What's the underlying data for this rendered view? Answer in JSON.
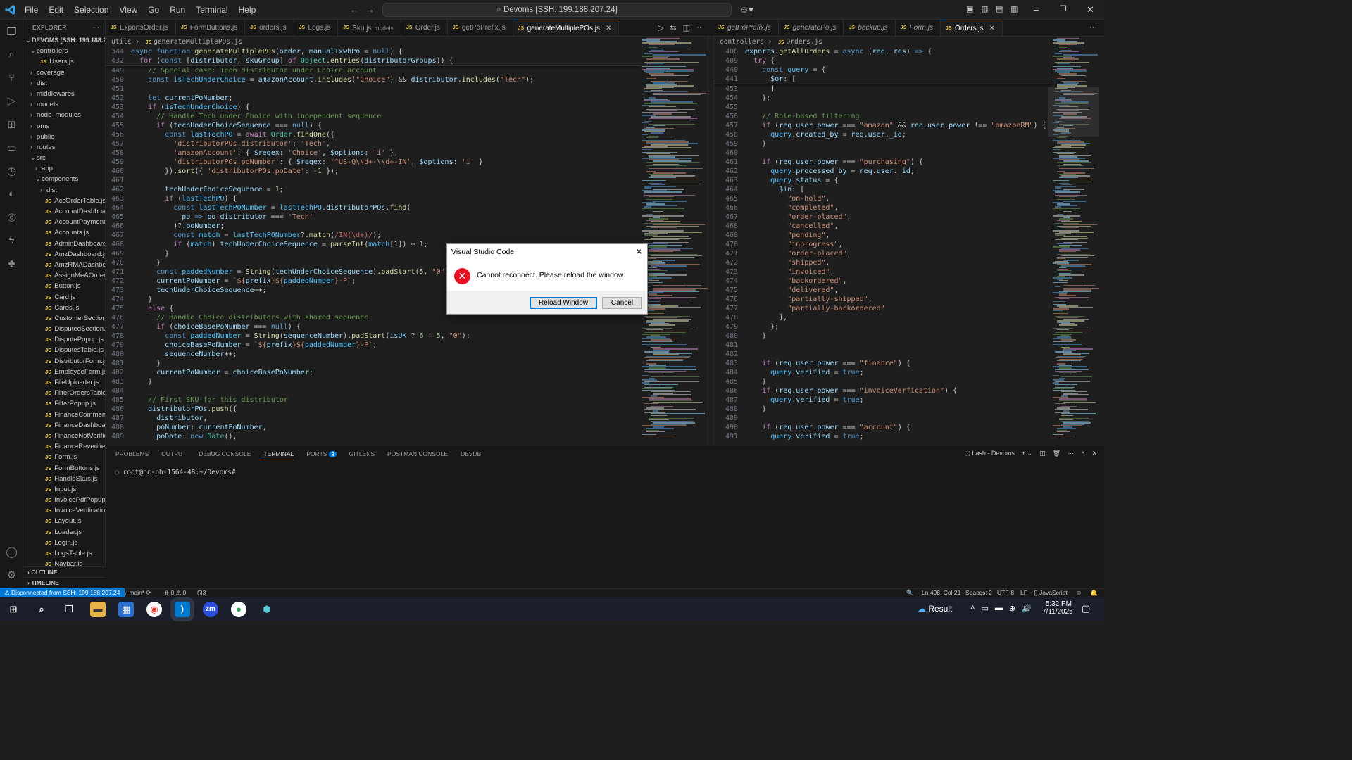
{
  "titlebar": {
    "menu": [
      "File",
      "Edit",
      "Selection",
      "View",
      "Go",
      "Run",
      "Terminal",
      "Help"
    ],
    "command_center": "Devoms [SSH: 199.188.207.24]"
  },
  "explorer": {
    "header": "EXPLORER",
    "root": "DEVOMS [SSH: 199.188.20...",
    "items": [
      {
        "label": "controllers",
        "type": "folder",
        "open": true,
        "depth": 1
      },
      {
        "label": "Users.js",
        "type": "js",
        "depth": 2
      },
      {
        "label": "coverage",
        "type": "folder",
        "depth": 1
      },
      {
        "label": "dist",
        "type": "folder",
        "depth": 1
      },
      {
        "label": "middlewares",
        "type": "folder",
        "depth": 1
      },
      {
        "label": "models",
        "type": "folder",
        "depth": 1
      },
      {
        "label": "node_modules",
        "type": "folder",
        "depth": 1
      },
      {
        "label": "oms",
        "type": "folder",
        "depth": 1
      },
      {
        "label": "public",
        "type": "folder",
        "depth": 1
      },
      {
        "label": "routes",
        "type": "folder",
        "depth": 1
      },
      {
        "label": "src",
        "type": "folder",
        "open": true,
        "depth": 1
      },
      {
        "label": "app",
        "type": "folder",
        "depth": 2
      },
      {
        "label": "components",
        "type": "folder",
        "open": true,
        "depth": 2
      },
      {
        "label": "dist",
        "type": "folder",
        "depth": 3
      },
      {
        "label": "AccOrderTable.js",
        "type": "js",
        "depth": 3
      },
      {
        "label": "AccountDashboar...",
        "type": "js",
        "depth": 3
      },
      {
        "label": "AccountPaymentP...",
        "type": "js",
        "depth": 3
      },
      {
        "label": "Accounts.js",
        "type": "js",
        "depth": 3
      },
      {
        "label": "AdminDashboard.js",
        "type": "js",
        "depth": 3
      },
      {
        "label": "AmzDashboard.js",
        "type": "js",
        "depth": 3
      },
      {
        "label": "AmzRMADashboar...",
        "type": "js",
        "depth": 3
      },
      {
        "label": "AssignMeAOrder.js",
        "type": "js",
        "depth": 3
      },
      {
        "label": "Button.js",
        "type": "js",
        "depth": 3
      },
      {
        "label": "Card.js",
        "type": "js",
        "depth": 3
      },
      {
        "label": "Cards.js",
        "type": "js",
        "depth": 3
      },
      {
        "label": "CustomerSection.js",
        "type": "js",
        "depth": 3
      },
      {
        "label": "DisputedSection.js",
        "type": "js",
        "depth": 3
      },
      {
        "label": "DisputePopup.js",
        "type": "js",
        "depth": 3
      },
      {
        "label": "DisputesTable.js",
        "type": "js",
        "depth": 3
      },
      {
        "label": "DistributorForm.js",
        "type": "js",
        "depth": 3
      },
      {
        "label": "EmployeeForm.js",
        "type": "js",
        "depth": 3
      },
      {
        "label": "FileUploader.js",
        "type": "js",
        "depth": 3
      },
      {
        "label": "FilterOrdersTable.js",
        "type": "js",
        "depth": 3
      },
      {
        "label": "FilterPopup.js",
        "type": "js",
        "depth": 3
      },
      {
        "label": "FinanceComments.js",
        "type": "js",
        "depth": 3
      },
      {
        "label": "FinanceDashboard.js",
        "type": "js",
        "depth": 3
      },
      {
        "label": "FinanceNotVerified...",
        "type": "js",
        "depth": 3
      },
      {
        "label": "FinanceReverified...",
        "type": "js",
        "depth": 3
      },
      {
        "label": "Form.js",
        "type": "js",
        "depth": 3
      },
      {
        "label": "FormButtons.js",
        "type": "js",
        "depth": 3
      },
      {
        "label": "HandleSkus.js",
        "type": "js",
        "depth": 3
      },
      {
        "label": "Input.js",
        "type": "js",
        "depth": 3
      },
      {
        "label": "InvoicePdfPopup.js",
        "type": "js",
        "depth": 3
      },
      {
        "label": "InvoiceVerification...",
        "type": "js",
        "depth": 3
      },
      {
        "label": "Layout.js",
        "type": "js",
        "depth": 3
      },
      {
        "label": "Loader.js",
        "type": "js",
        "depth": 3
      },
      {
        "label": "Login.js",
        "type": "js",
        "depth": 3
      },
      {
        "label": "LogsTable.js",
        "type": "js",
        "depth": 3
      },
      {
        "label": "Navbar.js",
        "type": "js",
        "depth": 3
      }
    ],
    "outline": "OUTLINE",
    "timeline": "TIMELINE"
  },
  "tabs_left": [
    {
      "label": "ExportsOrder.js"
    },
    {
      "label": "FormButtons.js"
    },
    {
      "label": "orders.js"
    },
    {
      "label": "Logs.js"
    },
    {
      "label": "Sku.js",
      "desc": "models"
    },
    {
      "label": "Order.js"
    },
    {
      "label": "getPoPrefix.js"
    },
    {
      "label": "generateMultiplePOs.js",
      "active": true
    }
  ],
  "tabs_right": [
    {
      "label": "getPoPrefix.js",
      "italic": true
    },
    {
      "label": "generatePo.js",
      "italic": true
    },
    {
      "label": "backup.js",
      "italic": true
    },
    {
      "label": "Form.js",
      "italic": true
    },
    {
      "label": "Orders.js",
      "active": true
    }
  ],
  "left_editor": {
    "breadcrumb": [
      "utils",
      "generateMultiplePOs.js"
    ],
    "sticky": [
      {
        "n": "344",
        "html": "<span class='kw'>async</span> <span class='kw'>function</span> <span class='fn'>generateMultiplePOs</span><span class='pun'>(</span><span class='var'>order</span>, <span class='var'>manualTxwhPo</span> = <span class='kw'>null</span><span class='pun'>) {</span>"
      },
      {
        "n": "432",
        "html": "  <span class='kw2'>for</span> (<span class='kw'>const</span> [<span class='var'>distributor</span>, <span class='var'>skuGroup</span>] <span class='kw2'>of</span> <span class='cls'>Object</span>.<span class='fn'>entries</span>(<span class='var'>distributorGroups</span>)) {"
      }
    ],
    "lines": [
      {
        "n": "449",
        "html": "    <span class='cmt'>// Special case: Tech distributor under Choice account</span>"
      },
      {
        "n": "450",
        "html": "    <span class='kw'>const</span> <span class='cst'>isTechUnderChoice</span> = <span class='var'>amazonAccount</span>.<span class='fn'>includes</span>(<span class='str'>\"Choice\"</span>) &amp;&amp; <span class='var'>distributor</span>.<span class='fn'>includes</span>(<span class='str'>\"Tech\"</span>);"
      },
      {
        "n": "451",
        "html": ""
      },
      {
        "n": "452",
        "html": "    <span class='kw'>let</span> <span class='var'>currentPoNumber</span>;"
      },
      {
        "n": "453",
        "html": "    <span class='kw2'>if</span> (<span class='cst'>isTechUnderChoice</span>) {"
      },
      {
        "n": "454",
        "html": "      <span class='cmt'>// Handle Tech under Choice with independent sequence</span>"
      },
      {
        "n": "455",
        "html": "      <span class='kw2'>if</span> (<span class='var'>techUnderChoiceSequence</span> === <span class='kw'>null</span>) {"
      },
      {
        "n": "456",
        "html": "        <span class='kw'>const</span> <span class='cst'>lastTechPO</span> = <span class='kw2'>await</span> <span class='cls'>Order</span>.<span class='fn'>findOne</span>({"
      },
      {
        "n": "457",
        "html": "          <span class='str'>'distributorPOs.distributor'</span>: <span class='str'>'Tech'</span>,"
      },
      {
        "n": "458",
        "html": "          <span class='str'>'amazonAccount'</span>: { <span class='var'>$regex</span>: <span class='str'>'Choice'</span>, <span class='var'>$options</span>: <span class='str'>'i'</span> },"
      },
      {
        "n": "459",
        "html": "          <span class='str'>'distributorPOs.poNumber'</span>: { <span class='var'>$regex</span>: <span class='str'>'^US-Q\\\\d+-\\\\d+-IN'</span>, <span class='var'>$options</span>: <span class='str'>'i'</span> }"
      },
      {
        "n": "460",
        "html": "        }).<span class='fn'>sort</span>({ <span class='str'>'distributorPOs.poDate'</span>: <span class='num'>-1</span> });"
      },
      {
        "n": "461",
        "html": ""
      },
      {
        "n": "462",
        "html": "        <span class='var'>techUnderChoiceSequence</span> = <span class='num'>1</span>;"
      },
      {
        "n": "463",
        "html": "        <span class='kw2'>if</span> (<span class='cst'>lastTechPO</span>) {"
      },
      {
        "n": "464",
        "html": "          <span class='kw'>const</span> <span class='cst'>lastTechPONumber</span> = <span class='cst'>lastTechPO</span>.<span class='var'>distributorPOs</span>.<span class='fn'>find</span>("
      },
      {
        "n": "465",
        "html": "            <span class='var'>po</span> <span class='kw'>=&gt;</span> <span class='var'>po</span>.<span class='var'>distributor</span> === <span class='str'>'Tech'</span>"
      },
      {
        "n": "466",
        "html": "          )?.<span class='var'>poNumber</span>;"
      },
      {
        "n": "467",
        "html": "          <span class='kw'>const</span> <span class='cst'>match</span> = <span class='cst'>lastTechPONumber</span>?.<span class='fn'>match</span>(<span class='rx'>/IN(\\d+)/</span>);"
      },
      {
        "n": "468",
        "html": "          <span class='kw2'>if</span> (<span class='cst'>match</span>) <span class='var'>techUnderChoiceSequence</span> = <span class='fn'>parseInt</span>(<span class='cst'>match</span>[<span class='num'>1</span>]) + <span class='num'>1</span>;"
      },
      {
        "n": "469",
        "html": "        }"
      },
      {
        "n": "470",
        "html": "      }"
      },
      {
        "n": "471",
        "html": "      <span class='kw'>const</span> <span class='cst'>paddedNumber</span> = <span class='fn'>String</span>(<span class='var'>techUnderChoiceSequence</span>).<span class='fn'>padStart</span>(<span class='num'>5</span>, <span class='str'>\"0\"</span>);"
      },
      {
        "n": "472",
        "html": "      <span class='var'>currentPoNumber</span> = <span class='str'>`${</span><span class='var'>prefix</span><span class='str'>}${</span><span class='cst'>paddedNumber</span><span class='str'>}-P`</span>;"
      },
      {
        "n": "473",
        "html": "      <span class='var'>techUnderChoiceSequence</span>++;"
      },
      {
        "n": "474",
        "html": "    }"
      },
      {
        "n": "475",
        "html": "    <span class='kw2'>else</span> {"
      },
      {
        "n": "476",
        "html": "      <span class='cmt'>// Handle Choice distributors with shared sequence</span>"
      },
      {
        "n": "477",
        "html": "      <span class='kw2'>if</span> (<span class='var'>choiceBasePoNumber</span> === <span class='kw'>null</span>) {"
      },
      {
        "n": "478",
        "html": "        <span class='kw'>const</span> <span class='cst'>paddedNumber</span> = <span class='fn'>String</span>(<span class='var'>sequenceNumber</span>).<span class='fn'>padStart</span>(<span class='var'>isUK</span> ? <span class='num'>6</span> : <span class='num'>5</span>, <span class='str'>\"0\"</span>);"
      },
      {
        "n": "479",
        "html": "        <span class='var'>choiceBasePoNumber</span> = <span class='str'>`${</span><span class='var'>prefix</span><span class='str'>}${</span><span class='cst'>paddedNumber</span><span class='str'>}-P`</span>;"
      },
      {
        "n": "480",
        "html": "        <span class='var'>sequenceNumber</span>++;"
      },
      {
        "n": "481",
        "html": "      }"
      },
      {
        "n": "482",
        "html": "      <span class='var'>currentPoNumber</span> = <span class='var'>choiceBasePoNumber</span>;"
      },
      {
        "n": "483",
        "html": "    }"
      },
      {
        "n": "484",
        "html": ""
      },
      {
        "n": "485",
        "html": "    <span class='cmt'>// First SKU for this distributor</span>"
      },
      {
        "n": "486",
        "html": "    <span class='var'>distributorPOs</span>.<span class='fn'>push</span>({"
      },
      {
        "n": "487",
        "html": "      <span class='var'>distributor</span>,"
      },
      {
        "n": "488",
        "html": "      <span class='var'>poNumber</span>: <span class='var'>currentPoNumber</span>,"
      },
      {
        "n": "489",
        "html": "      <span class='var'>poDate</span>: <span class='kw'>new</span> <span class='cls'>Date</span>(),"
      }
    ]
  },
  "right_editor": {
    "breadcrumb": [
      "controllers",
      "Orders.js"
    ],
    "sticky": [
      {
        "n": "408",
        "html": "<span class='var'>exports</span>.<span class='fn'>getAllOrders</span> = <span class='kw'>async</span> (<span class='var'>req</span>, <span class='var'>res</span>) <span class='kw'>=&gt;</span> {"
      },
      {
        "n": "409",
        "html": "  <span class='kw2'>try</span> {"
      },
      {
        "n": "440",
        "html": "    <span class='kw'>const</span> <span class='cst'>query</span> = {"
      },
      {
        "n": "441",
        "html": "      <span class='var'>$or</span>: ["
      }
    ],
    "lines": [
      {
        "n": "453",
        "html": "      ]"
      },
      {
        "n": "454",
        "html": "    };"
      },
      {
        "n": "455",
        "html": ""
      },
      {
        "n": "456",
        "html": "    <span class='cmt'>// Role-based filtering</span>"
      },
      {
        "n": "457",
        "html": "    <span class='kw2'>if</span> (<span class='var'>req</span>.<span class='var'>user</span>.<span class='var'>power</span> === <span class='str'>\"amazon\"</span> &amp;&amp; <span class='var'>req</span>.<span class='var'>user</span>.<span class='var'>power</span> !== <span class='str'>\"amazonRM\"</span>) {"
      },
      {
        "n": "458",
        "html": "      <span class='cst'>query</span>.<span class='var'>created_by</span> = <span class='var'>req</span>.<span class='var'>user</span>.<span class='var'>_id</span>;"
      },
      {
        "n": "459",
        "html": "    }"
      },
      {
        "n": "460",
        "html": ""
      },
      {
        "n": "461",
        "html": "    <span class='kw2'>if</span> (<span class='var'>req</span>.<span class='var'>user</span>.<span class='var'>power</span> === <span class='str'>\"purchasing\"</span>) {"
      },
      {
        "n": "462",
        "html": "      <span class='cst'>query</span>.<span class='var'>processed_by</span> = <span class='var'>req</span>.<span class='var'>user</span>.<span class='var'>_id</span>;"
      },
      {
        "n": "463",
        "html": "      <span class='cst'>query</span>.<span class='var'>status</span> = {"
      },
      {
        "n": "464",
        "html": "        <span class='var'>$in</span>: ["
      },
      {
        "n": "465",
        "html": "          <span class='str'>\"on-hold\"</span>,"
      },
      {
        "n": "466",
        "html": "          <span class='str'>\"completed\"</span>,"
      },
      {
        "n": "467",
        "html": "          <span class='str'>\"order-placed\"</span>,"
      },
      {
        "n": "468",
        "html": "          <span class='str'>\"cancelled\"</span>,"
      },
      {
        "n": "469",
        "html": "          <span class='str'>\"pending\"</span>,"
      },
      {
        "n": "470",
        "html": "          <span class='str'>\"inprogress\"</span>,"
      },
      {
        "n": "471",
        "html": "          <span class='str'>\"order-placed\"</span>,"
      },
      {
        "n": "472",
        "html": "          <span class='str'>\"shipped\"</span>,"
      },
      {
        "n": "473",
        "html": "          <span class='str'>\"invoiced\"</span>,"
      },
      {
        "n": "474",
        "html": "          <span class='str'>\"backordered\"</span>,"
      },
      {
        "n": "475",
        "html": "          <span class='str'>\"delivered\"</span>,"
      },
      {
        "n": "476",
        "html": "          <span class='str'>\"partially-shipped\"</span>,"
      },
      {
        "n": "477",
        "html": "          <span class='str'>\"partially-backordered\"</span>"
      },
      {
        "n": "478",
        "html": "        ],"
      },
      {
        "n": "479",
        "html": "      };"
      },
      {
        "n": "480",
        "html": "    }"
      },
      {
        "n": "481",
        "html": ""
      },
      {
        "n": "482",
        "html": ""
      },
      {
        "n": "483",
        "html": "    <span class='kw2'>if</span> (<span class='var'>req</span>.<span class='var'>user</span>.<span class='var'>power</span> === <span class='str'>\"finance\"</span>) {"
      },
      {
        "n": "484",
        "html": "      <span class='cst'>query</span>.<span class='var'>verified</span> = <span class='kw'>true</span>;"
      },
      {
        "n": "485",
        "html": "    }"
      },
      {
        "n": "486",
        "html": "    <span class='kw2'>if</span> (<span class='var'>req</span>.<span class='var'>user</span>.<span class='var'>power</span> === <span class='str'>\"invoiceVerfication\"</span>) {"
      },
      {
        "n": "487",
        "html": "      <span class='cst'>query</span>.<span class='var'>verified</span> = <span class='kw'>true</span>;"
      },
      {
        "n": "488",
        "html": "    }"
      },
      {
        "n": "489",
        "html": ""
      },
      {
        "n": "490",
        "html": "    <span class='kw2'>if</span> (<span class='var'>req</span>.<span class='var'>user</span>.<span class='var'>power</span> === <span class='str'>\"account\"</span>) {"
      },
      {
        "n": "491",
        "html": "      <span class='cst'>query</span>.<span class='var'>verified</span> = <span class='kw'>true</span>;"
      }
    ]
  },
  "panel": {
    "tabs": [
      "PROBLEMS",
      "OUTPUT",
      "DEBUG CONSOLE",
      "TERMINAL",
      "PORTS",
      "GITLENS",
      "POSTMAN CONSOLE",
      "DEVDB"
    ],
    "active_tab": "TERMINAL",
    "ports_badge": "3",
    "terminal_name": "bash - Devoms",
    "prompt": "root@nc-ph-1564-48:~/Devoms#"
  },
  "statusbar": {
    "remote": "Disconnected from SSH: 199.188.207.24",
    "branch": "main*",
    "problems": "0 ⚠ 0",
    "ports": "3",
    "position": "Ln 498, Col 21",
    "spaces": "Spaces: 2",
    "encoding": "UTF-8",
    "eol": "LF",
    "language": "JavaScript"
  },
  "dialog": {
    "title": "Visual Studio Code",
    "message": "Cannot reconnect. Please reload the window.",
    "primary_button": "Reload Window",
    "cancel_button": "Cancel"
  },
  "taskbar": {
    "weather": "Result",
    "time": "5:32 PM",
    "date": "7/11/2025"
  },
  "colors": {
    "accent": "#0078d4",
    "error": "#e81123",
    "js_icon": "#e8c547"
  }
}
